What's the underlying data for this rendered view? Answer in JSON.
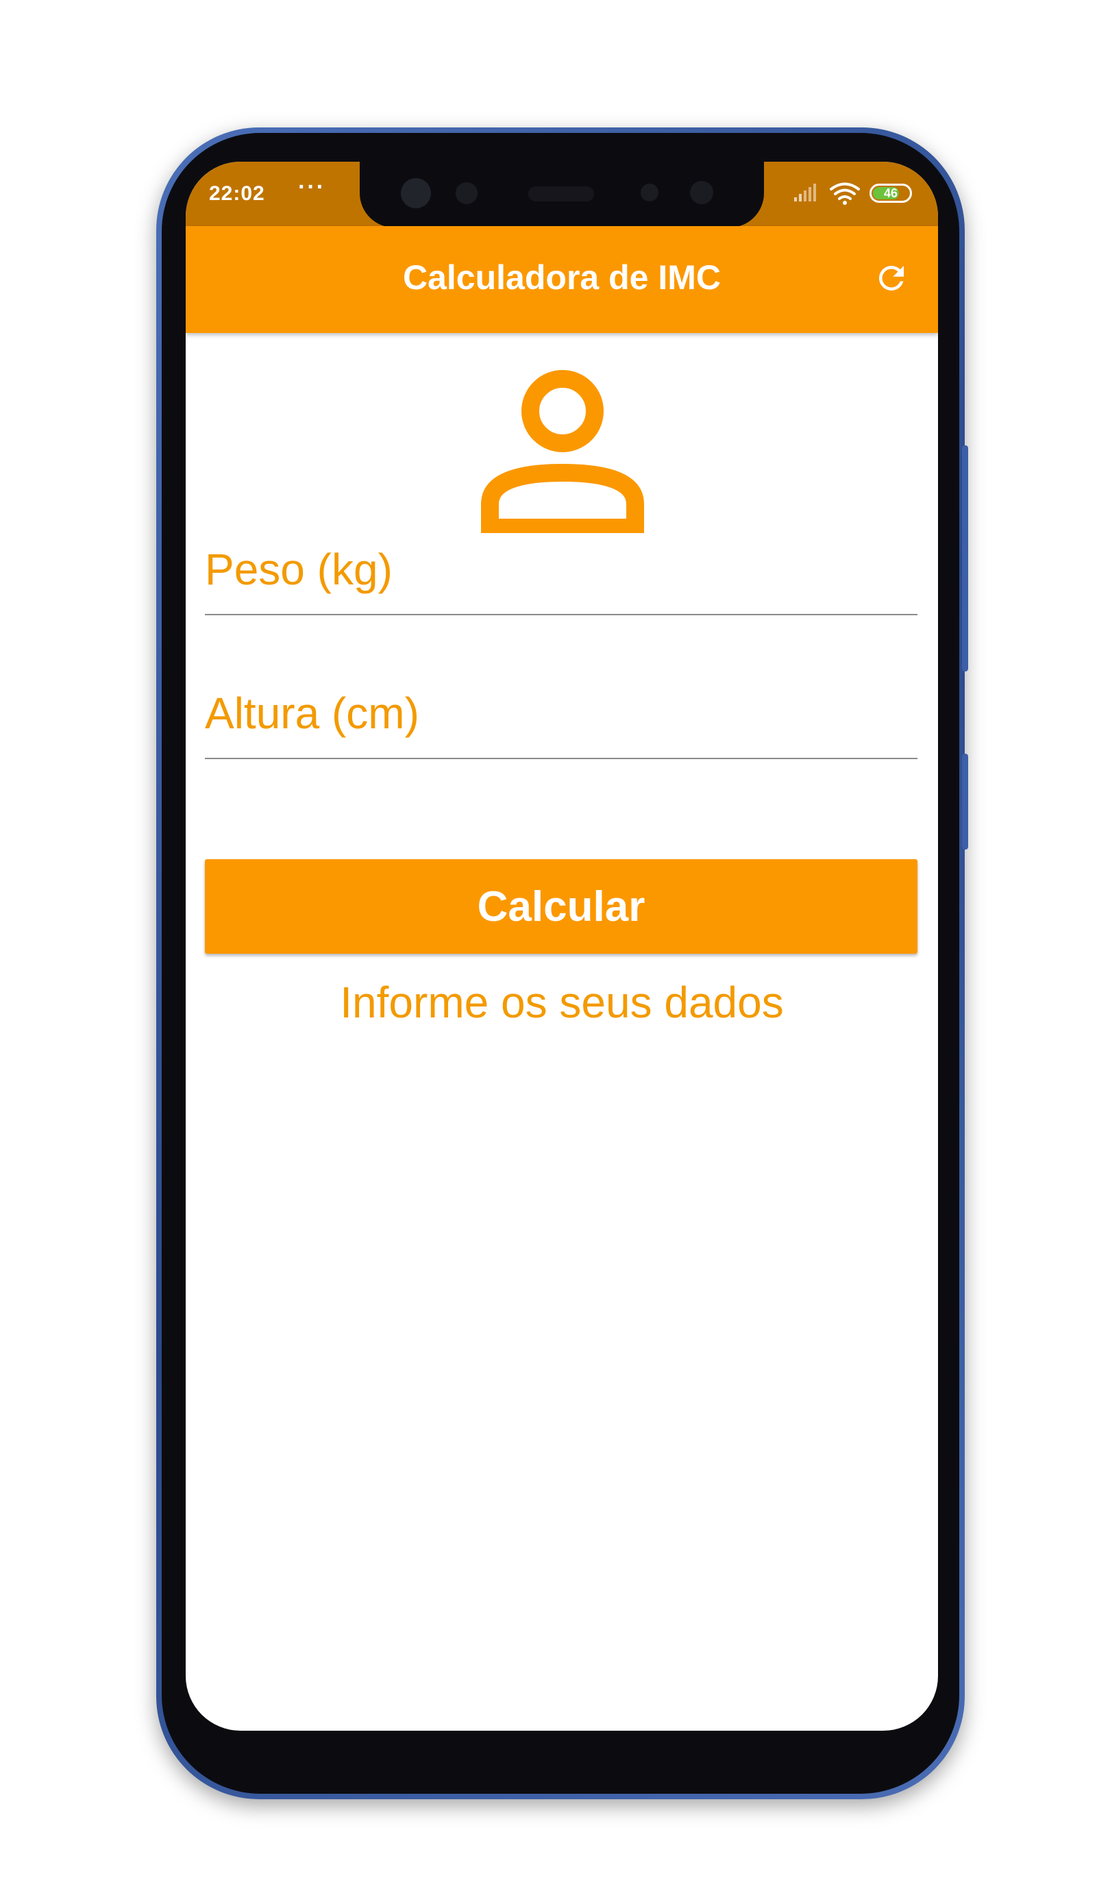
{
  "status_bar": {
    "time": "22:02",
    "dots": "···",
    "battery": "46"
  },
  "app_bar": {
    "title": "Calculadora de IMC",
    "refresh_icon": "refresh-icon"
  },
  "form": {
    "weight_placeholder": "Peso (kg)",
    "height_placeholder": "Altura (cm)",
    "calculate_label": "Calcular",
    "info": "Informe os seus dados"
  },
  "colors": {
    "accent": "#fb9800",
    "status_bar": "#c07400",
    "text_accent": "#f39a00",
    "battery_fill": "#6cc23b"
  }
}
